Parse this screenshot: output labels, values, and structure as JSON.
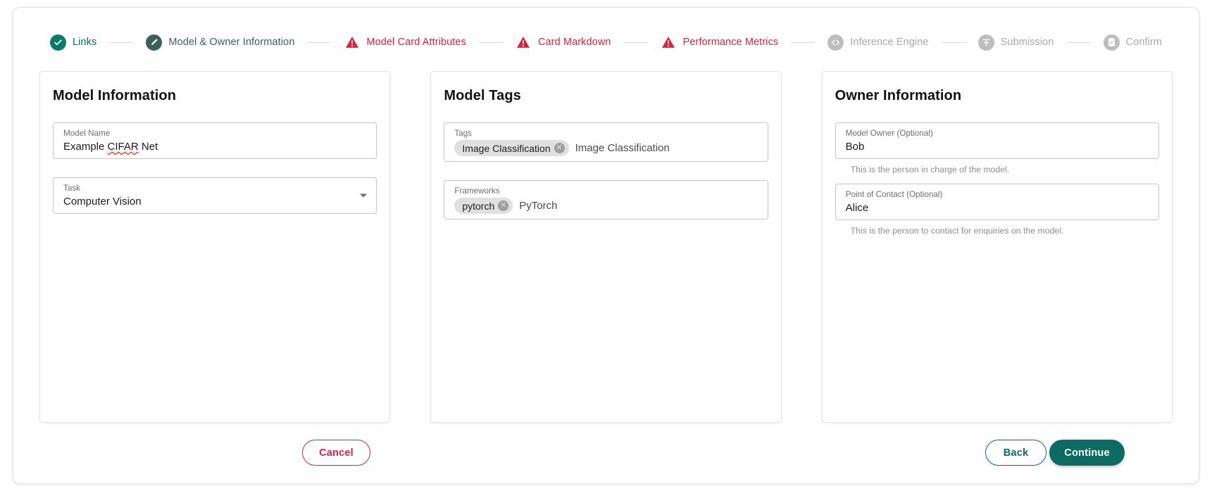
{
  "stepper": {
    "steps": [
      {
        "label": "Links",
        "icon": "check-circle-icon",
        "state": "done"
      },
      {
        "label": "Model & Owner Information",
        "icon": "pencil-icon",
        "state": "active"
      },
      {
        "label": "Model Card Attributes",
        "icon": "warning-triangle-icon",
        "state": "error"
      },
      {
        "label": "Card Markdown",
        "icon": "warning-triangle-icon",
        "state": "error"
      },
      {
        "label": "Performance Metrics",
        "icon": "warning-triangle-icon",
        "state": "error"
      },
      {
        "label": "Inference Engine",
        "icon": "code-brackets-icon",
        "state": "todo"
      },
      {
        "label": "Submission",
        "icon": "upload-icon",
        "state": "todo"
      },
      {
        "label": "Confirm",
        "icon": "document-check-icon",
        "state": "todo"
      }
    ]
  },
  "model_information": {
    "title": "Model Information",
    "model_name": {
      "label": "Model Name",
      "value_prefix": "Example ",
      "value_misspelled": "CIFAR",
      "value_suffix": " Net"
    },
    "task": {
      "label": "Task",
      "value": "Computer Vision"
    }
  },
  "model_tags": {
    "title": "Model Tags",
    "tags": {
      "label": "Tags",
      "chip": "Image Classification",
      "chip_remove": "✕",
      "suggestion": "Image Classification"
    },
    "frameworks": {
      "label": "Frameworks",
      "chip": "pytorch",
      "chip_remove": "✕",
      "suggestion": "PyTorch"
    }
  },
  "owner_information": {
    "title": "Owner Information",
    "model_owner": {
      "label": "Model Owner (Optional)",
      "value": "Bob",
      "helper": "This is the person in charge of the model."
    },
    "point_of_contact": {
      "label": "Point of Contact (Optional)",
      "value": "Alice",
      "helper": "This is the person to contact for enquiries on the model."
    }
  },
  "footer": {
    "cancel_label": "Cancel",
    "back_label": "Back",
    "continue_label": "Continue"
  },
  "colors": {
    "brand_teal": "#0c6b63",
    "active_slate": "#3c5f5b",
    "error_red": "#e01f3d",
    "muted_grey": "#bdbdbd"
  }
}
